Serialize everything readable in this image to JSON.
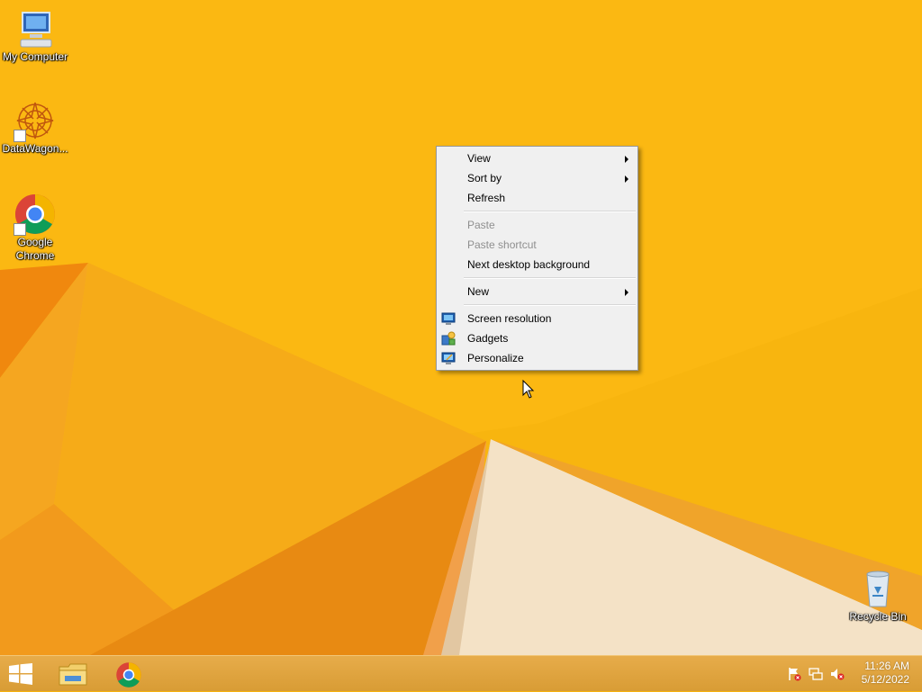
{
  "desktop": {
    "icons": [
      {
        "label": "My Computer"
      },
      {
        "label": "DataWagon..."
      },
      {
        "label": "Google Chrome"
      },
      {
        "label": "Recycle Bin"
      }
    ]
  },
  "context_menu": {
    "items": [
      {
        "label": "View"
      },
      {
        "label": "Sort by"
      },
      {
        "label": "Refresh"
      },
      {
        "label": "Paste"
      },
      {
        "label": "Paste shortcut"
      },
      {
        "label": "Next desktop background"
      },
      {
        "label": "New"
      },
      {
        "label": "Screen resolution"
      },
      {
        "label": "Gadgets"
      },
      {
        "label": "Personalize"
      }
    ]
  },
  "taskbar": {
    "clock": {
      "time": "11:26 AM",
      "date": "5/12/2022"
    }
  },
  "colors": {
    "wallpaper": "#f7b20e",
    "taskbar": "#d89c35",
    "menu": "#f0f0f0"
  }
}
